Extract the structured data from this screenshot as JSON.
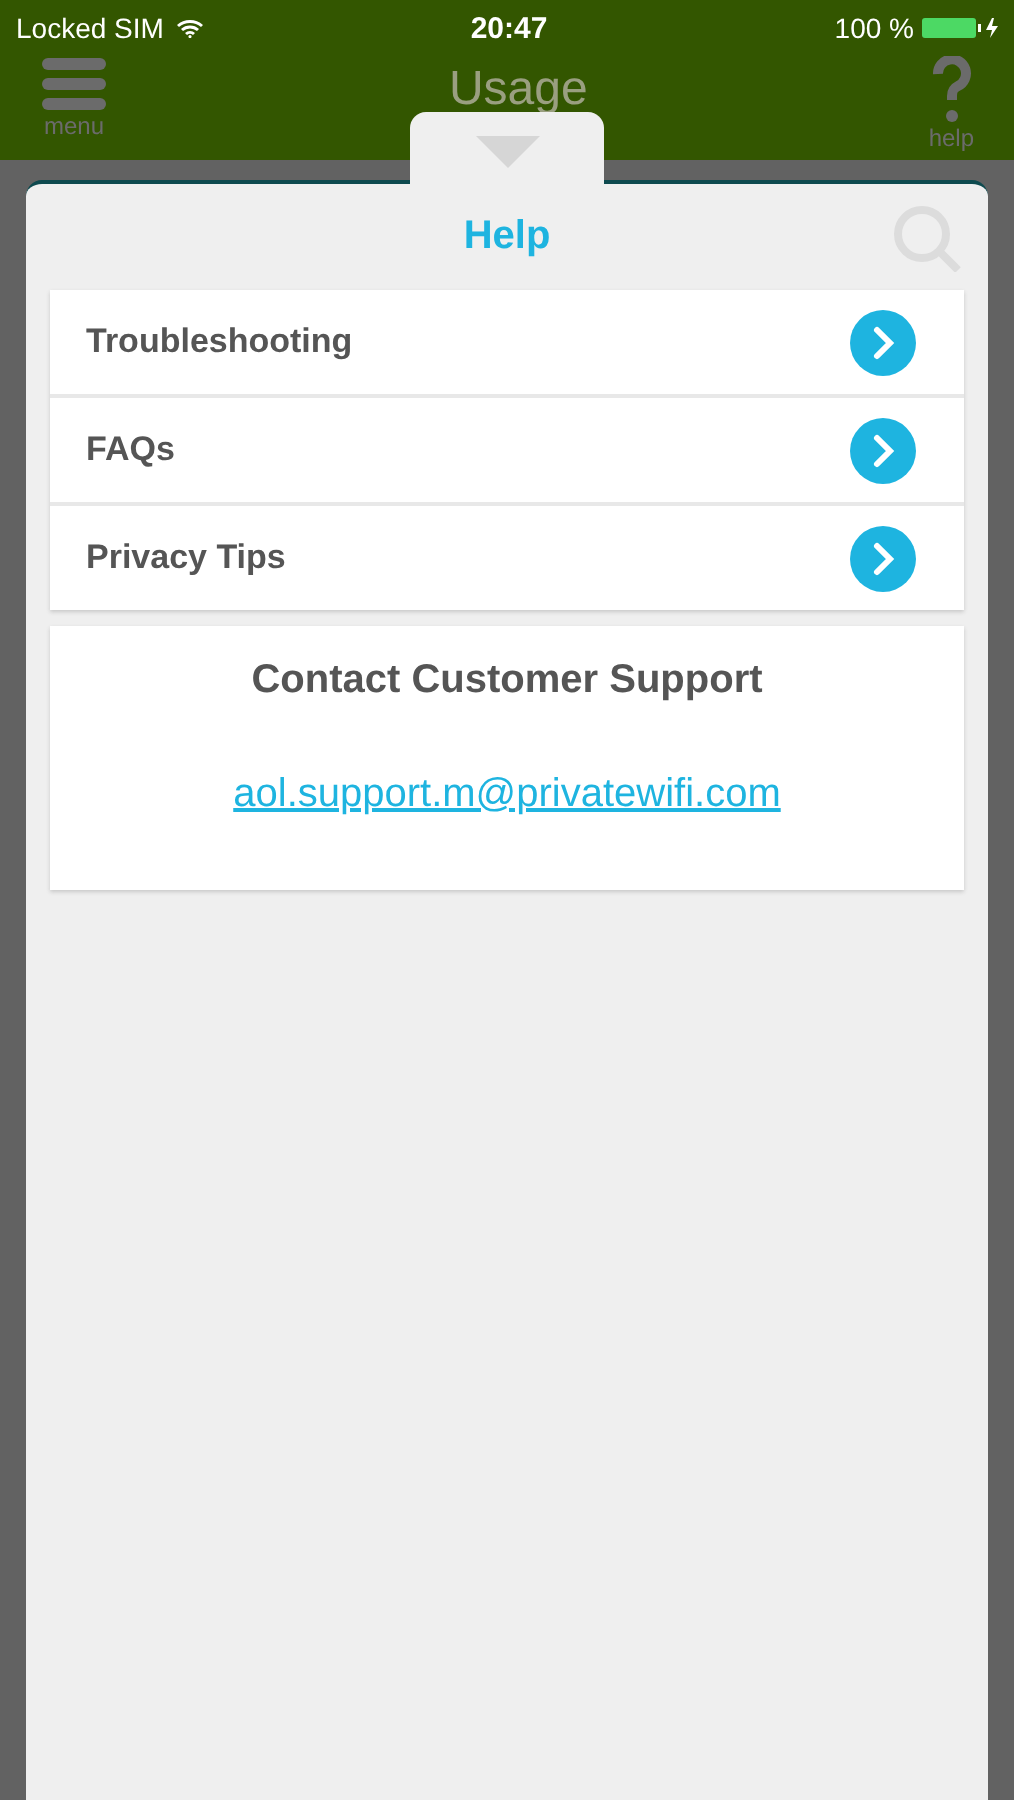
{
  "status_bar": {
    "carrier": "Locked SIM",
    "time": "20:47",
    "battery": "100 %"
  },
  "nav_bar": {
    "menu_label": "menu",
    "title": "Usage",
    "help_label": "help"
  },
  "help_panel": {
    "title": "Help",
    "items": [
      {
        "label": "Troubleshooting"
      },
      {
        "label": "FAQs"
      },
      {
        "label": "Privacy Tips"
      }
    ],
    "contact": {
      "heading": "Contact Customer Support",
      "email": "aol.support.m@privatewifi.com"
    }
  }
}
